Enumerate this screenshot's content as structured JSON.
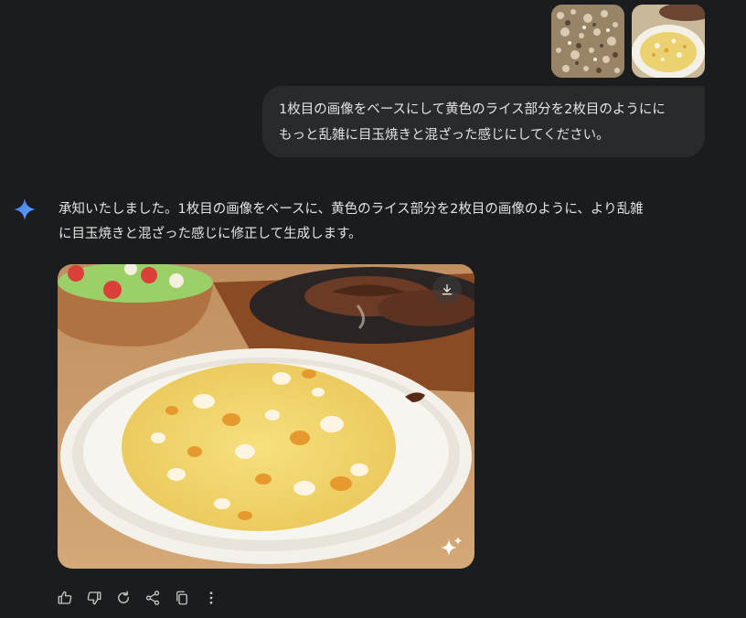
{
  "user_message": {
    "line1": "1枚目の画像をベースにして黄色のライス部分を2枚目のようにに",
    "line2": "もっと乱雑に目玉焼きと混ざった感じにしてください。"
  },
  "assistant_message": {
    "line1": "承知いたしました。1枚目の画像をベースに、黄色のライス部分を2枚目の画像のように、より乱雑",
    "line2": "に目玉焼きと混ざった感じに修正して生成します。"
  },
  "icons": {
    "assistant": "gemini-spark-icon",
    "download": "download-icon",
    "watermark": "sparkle-icon",
    "actions": [
      "thumbs-up-icon",
      "thumbs-down-icon",
      "regenerate-icon",
      "share-icon",
      "copy-icon",
      "more-vertical-icon"
    ]
  },
  "colors": {
    "background": "#1b1c1d",
    "bubble": "#282a2c",
    "accent": "#4c8df6",
    "icon": "#c4c7c5"
  }
}
